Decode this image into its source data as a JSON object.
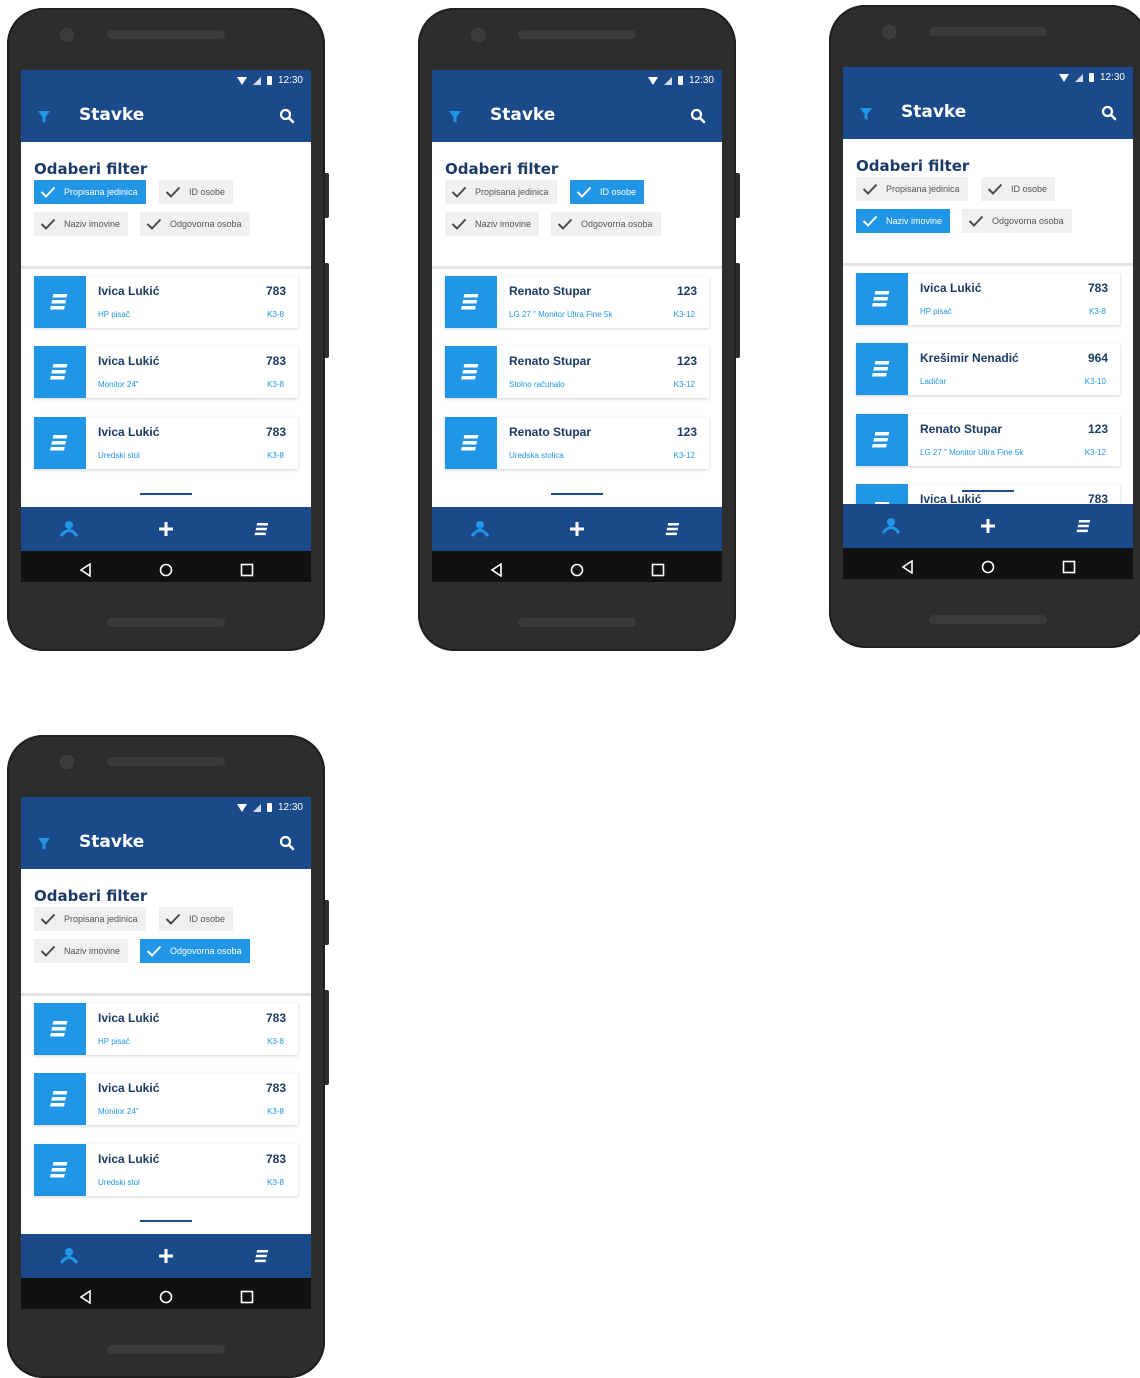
{
  "status": {
    "time": "12:30"
  },
  "appbar": {
    "title": "Stavke"
  },
  "filter": {
    "title": "Odaberi filter",
    "chips": [
      "Propisana jedinica",
      "ID osobe",
      "Naziv imovine",
      "Odgovorna osoba"
    ]
  },
  "colors": {
    "primary": "#1b4a8a",
    "accent": "#2196e6",
    "chip": "#f0f0f0"
  },
  "icons": [
    "filter-icon",
    "search-icon",
    "check-icon",
    "list-icon",
    "person-icon",
    "plus-icon",
    "back-icon",
    "home-icon",
    "recents-icon"
  ],
  "screens": [
    {
      "active_chip": 0,
      "items": [
        {
          "name": "Ivica Lukić",
          "num": "783",
          "desc": "HP pisač",
          "code": "K3-8"
        },
        {
          "name": "Ivica Lukić",
          "num": "783",
          "desc": "Monitor 24\"",
          "code": "K3-8"
        },
        {
          "name": "Ivica Lukić",
          "num": "783",
          "desc": "Uredski stol",
          "code": "K3-8"
        }
      ]
    },
    {
      "active_chip": 1,
      "items": [
        {
          "name": "Renato Stupar",
          "num": "123",
          "desc": "LG 27 \" Monitor Ultra Fine 5k",
          "code": "K3-12"
        },
        {
          "name": "Renato Stupar",
          "num": "123",
          "desc": "Stolno računalo",
          "code": "K3-12"
        },
        {
          "name": "Renato Stupar",
          "num": "123",
          "desc": "Uredska stolica",
          "code": "K3-12"
        }
      ]
    },
    {
      "active_chip": 2,
      "items": [
        {
          "name": "Ivica Lukić",
          "num": "783",
          "desc": "HP pisač",
          "code": "K3-8"
        },
        {
          "name": "Krešimir Nenadić",
          "num": "964",
          "desc": "Ladičar",
          "code": "K3-10"
        },
        {
          "name": "Renato Stupar",
          "num": "123",
          "desc": "LG 27 \" Monitor Ultra Fine 5k",
          "code": "K3-12"
        },
        {
          "name": "Ivica Lukić",
          "num": "783",
          "desc": "",
          "code": ""
        }
      ]
    },
    {
      "active_chip": 3,
      "items": [
        {
          "name": "Ivica Lukić",
          "num": "783",
          "desc": "HP pisač",
          "code": "K3-8"
        },
        {
          "name": "Ivica Lukić",
          "num": "783",
          "desc": "Monitor 24\"",
          "code": "K3-8"
        },
        {
          "name": "Ivica Lukić",
          "num": "783",
          "desc": "Uredski stol",
          "code": "K3-8"
        }
      ]
    }
  ]
}
